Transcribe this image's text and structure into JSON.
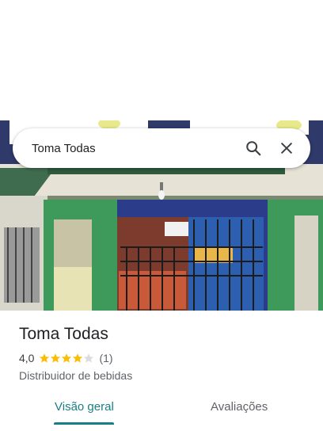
{
  "search": {
    "query": "Toma Todas"
  },
  "place": {
    "name": "Toma Todas",
    "rating_value": "4,0",
    "rating_stars": 4,
    "rating_max": 5,
    "review_count": "(1)",
    "category": "Distribuidor de bebidas"
  },
  "tabs": [
    {
      "label": "Visão geral",
      "selected": true
    },
    {
      "label": "Avaliações",
      "selected": false
    }
  ],
  "colors": {
    "accent": "#1a7f84",
    "star_filled": "#fbbc04",
    "star_empty": "#dadce0"
  },
  "icons": {
    "search": "search-icon",
    "close": "close-icon",
    "star": "star-icon"
  }
}
